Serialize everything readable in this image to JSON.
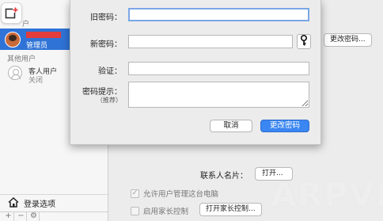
{
  "colors": {
    "accent": "#3a86f2",
    "selection": "#2f73d6",
    "redaction": "#e23c3c"
  },
  "sidebar": {
    "current_users_label": "户",
    "admin_role": "管理员",
    "other_users_label": "其他用户",
    "guest_name": "客人用户",
    "guest_status": "关闭",
    "login_options_label": "登录选项",
    "toolbar": {
      "add": "+",
      "remove": "−",
      "settings": "⚙"
    }
  },
  "main": {
    "change_password_button": "更改密码...",
    "contact_card_label": "联系人名片：",
    "open_button": "打开...",
    "allow_admin_label": "允许用户管理这台电脑",
    "parental_label": "启用家长控制",
    "open_parental_button": "打开家长控制...",
    "watermark": "ARPVR"
  },
  "dialog": {
    "old_password_label": "旧密码：",
    "new_password_label": "新密码：",
    "verify_label": "验证：",
    "hint_label": "密码提示：",
    "hint_sub": "（推荐）",
    "old_password_value": "",
    "new_password_value": "",
    "verify_value": "",
    "hint_value": "",
    "cancel_label": "取消",
    "submit_label": "更改密码"
  },
  "icons": {
    "add_user": "add-user-icon",
    "key": "key-icon",
    "home": "home-icon",
    "guest": "guest-avatar-icon"
  }
}
